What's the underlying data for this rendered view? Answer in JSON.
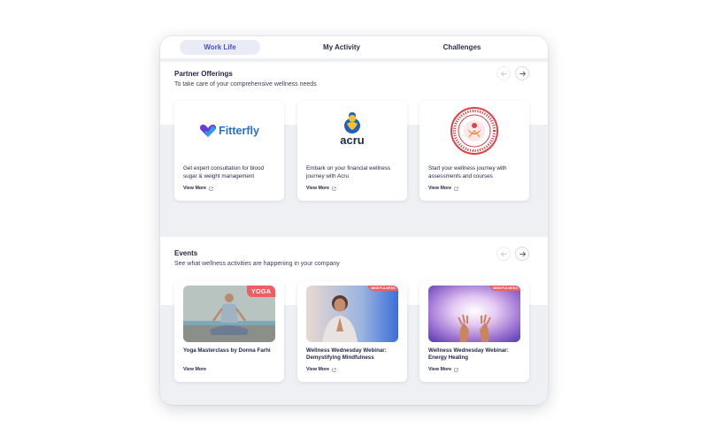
{
  "tabs": [
    {
      "label": "Work Life",
      "active": true
    },
    {
      "label": "My Activity",
      "active": false
    },
    {
      "label": "Challenges",
      "active": false
    }
  ],
  "partners": {
    "title": "Partner Offerings",
    "subtitle": "To take care of your comprehensive wellness needs",
    "cards": [
      {
        "logo_text": "Fitterfly",
        "description": "Get expert consultation for blood sugar & weight management",
        "link": "View More"
      },
      {
        "logo_text": "acru",
        "description": "Embark on your financial wellness journey with Acru",
        "link": "View More"
      },
      {
        "logo_text": "WELLNESS SPEAKS ACADEMY",
        "description": "Start your wellness journey with assessments and courses",
        "link": "View More"
      }
    ]
  },
  "events": {
    "title": "Events",
    "subtitle": "See what wellness activities are happening in your company",
    "cards": [
      {
        "tag": "YOGA",
        "title": "Yoga Masterclass by Donna Farhi",
        "link": "View More"
      },
      {
        "tag": "MINDFULNESS",
        "title": "Wellness Wednesday Webinar: Demystifying Mindfulness",
        "link": "View More"
      },
      {
        "tag": "MINDFULNESS",
        "title": "Wellness Wednesday Webinar: Energy Healing",
        "link": "View More"
      }
    ]
  },
  "colors": {
    "accent": "#4a4fd0",
    "tag": "#f05d63",
    "background": "#eef0f4"
  },
  "icons": {
    "prev": "arrow-left-icon",
    "next": "arrow-right-icon",
    "external": "external-link-icon"
  }
}
